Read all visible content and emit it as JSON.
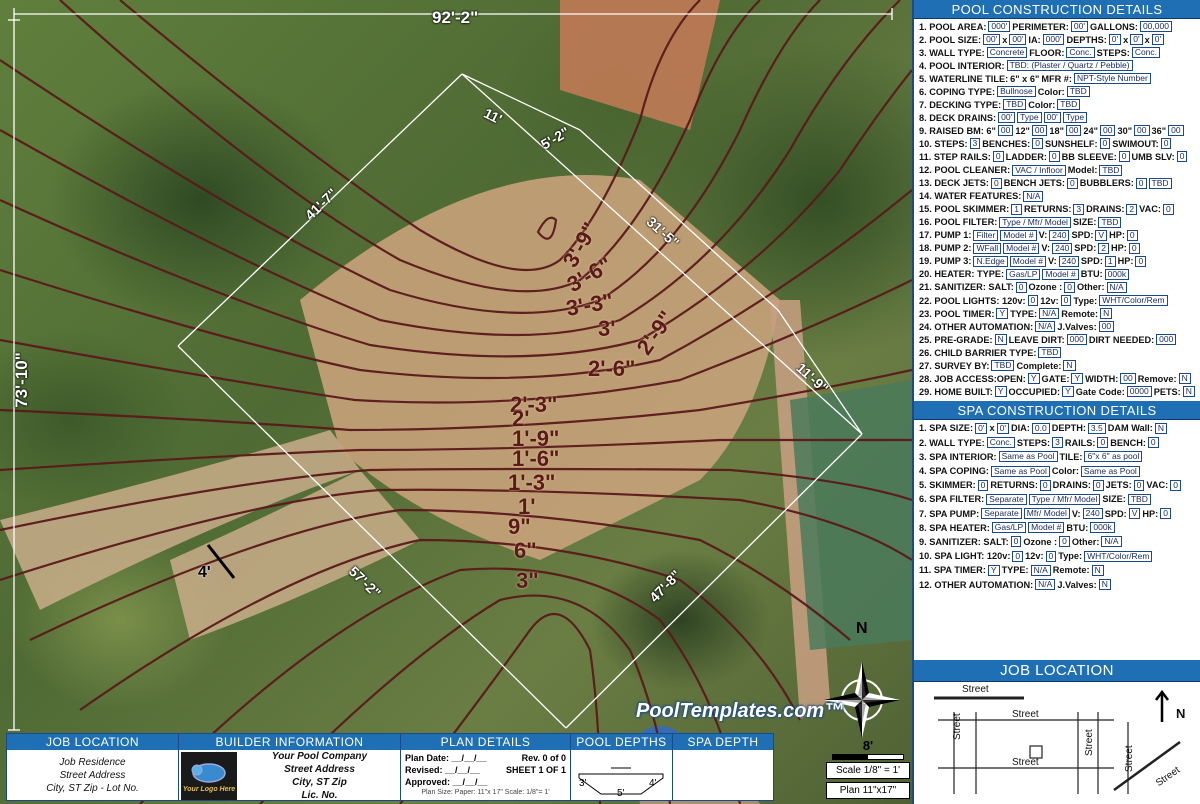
{
  "map": {
    "dimensions": [
      "92'-2\"",
      "73'-10\"",
      "41'-7\"",
      "11'",
      "5'-2\"",
      "31'-5\"",
      "11'-9\"",
      "57'-2\"",
      "47'-8\"",
      "4'"
    ],
    "depth_labels": [
      "3'-9\"",
      "3'-6\"",
      "3'-3\"",
      "3'",
      "2'-9\"",
      "2'-6\"",
      "2'-3\"",
      "2'",
      "1'-9\"",
      "1'-6\"",
      "1'-3\"",
      "1'",
      "9\"",
      "6\"",
      "3\""
    ],
    "watermark": "PoolTemplates.com™",
    "north": "N",
    "scale_bar_label": "8'",
    "scale": "Scale 1/8\" = 1'",
    "plan_size": "Plan 11\"x17\""
  },
  "title_block": {
    "job_location": {
      "header": "JOB LOCATION",
      "lines": [
        "Job Residence",
        "Street Address",
        "City, ST Zip -  Lot No."
      ]
    },
    "builder": {
      "header": "BUILDER INFORMATION",
      "logo_text": "Your Logo Here",
      "lines": [
        "Your Pool Company",
        "Street Address",
        "City, ST Zip",
        "Lic. No."
      ]
    },
    "plan": {
      "header": "PLAN DETAILS",
      "plan_date": "Plan Date:  __/__/__",
      "revised": "Revised:  __/__/__",
      "approved": "Approved:  __/__/__",
      "rev": "Rev. 0 of 0",
      "sheet": "SHEET 1 OF 1",
      "size": "Plan Size:  Paper: 11\"x 17\"  Scale: 1/8\"= 1'"
    },
    "pool_depths": {
      "header": "POOL DEPTHS",
      "shallow": "3'",
      "deep": "4'",
      "mid": "5'"
    },
    "spa_depth": {
      "header": "SPA DEPTH"
    }
  },
  "panel": {
    "pool_header": "POOL CONSTRUCTION DETAILS",
    "pool_rows": [
      [
        "1. POOL AREA:",
        "000'",
        "PERIMETER:",
        "00'",
        "GALLONS:",
        "00,000"
      ],
      [
        "2. POOL SIZE:",
        "00'",
        "x",
        "00'",
        "IA:",
        "000'",
        "DEPTHS:",
        "0'",
        "x",
        "0'",
        "x",
        "0'"
      ],
      [
        "3. WALL TYPE:",
        "Concrete",
        "FLOOR:",
        "Conc.",
        "STEPS:",
        "Conc."
      ],
      [
        "4. POOL INTERIOR:",
        "TBD: (Plaster / Quartz / Pebble)"
      ],
      [
        "5. WATERLINE TILE:",
        "6\" x 6\"",
        "MFR #:",
        "NPT-Style Number"
      ],
      [
        "6. COPING TYPE:",
        "Bullnose",
        "Color:",
        "TBD"
      ],
      [
        "7. DECKING TYPE:",
        "TBD",
        "Color:",
        "TBD"
      ],
      [
        "8. DECK DRAINS:",
        "00'",
        "Type",
        "00'",
        "Type"
      ],
      [
        "9. RAISED BM: 6\"",
        "00",
        "12\"",
        "00",
        "18\"",
        "00",
        "24\"",
        "00",
        "30\"",
        "00",
        "36\"",
        "00"
      ],
      [
        "10. STEPS:",
        "3",
        "BENCHES:",
        "0",
        "SUNSHELF:",
        "0",
        "SWIMOUT:",
        "0"
      ],
      [
        "11. STEP RAILS:",
        "0",
        "LADDER:",
        "0",
        "BB SLEEVE:",
        "0",
        "UMB SLV:",
        "0"
      ],
      [
        "12. POOL CLEANER:",
        "VAC / Infloor",
        "Model:",
        "TBD"
      ],
      [
        "13. DECK JETS:",
        "0",
        "BENCH JETS:",
        "0",
        "BUBBLERS:",
        "0",
        "TBD"
      ],
      [
        "14. WATER FEATURES:",
        "N/A"
      ],
      [
        "15. POOL SKIMMER:",
        "1",
        "RETURNS:",
        "3",
        "DRAINS:",
        "2",
        "VAC:",
        "0"
      ],
      [
        "16. POOL FILTER:",
        "Type / Mfr/ Model",
        "SIZE:",
        "TBD"
      ],
      [
        "17. PUMP 1:",
        "Filter",
        "Model #",
        "V:",
        "240",
        "SPD:",
        "V",
        "HP:",
        "0"
      ],
      [
        "18. PUMP 2:",
        "WFall",
        "Model #",
        "V:",
        "240",
        "SPD:",
        "2",
        "HP:",
        "0"
      ],
      [
        "19. PUMP 3:",
        "N.Edge",
        "Model #",
        "V:",
        "240",
        "SPD:",
        "1",
        "HP:",
        "0"
      ],
      [
        "20. HEATER: TYPE:",
        "Gas/LP",
        "Model #",
        "BTU:",
        "000k"
      ],
      [
        "21. SANITIZER:  SALT:",
        "0",
        "Ozone :",
        "0",
        "Other:",
        "N/A"
      ],
      [
        "22. POOL LIGHTS: 120v:",
        "0",
        "12v:",
        "0",
        "Type:",
        "WHT/Color/Rem"
      ],
      [
        "23. POOL TIMER:",
        "Y",
        "TYPE:",
        "N/A",
        "Remote:",
        "N"
      ],
      [
        "24. OTHER AUTOMATION:",
        "N/A",
        "J.Valves:",
        "00"
      ],
      [
        "25. PRE-GRADE:",
        "N",
        "LEAVE DIRT:",
        "000",
        "DIRT NEEDED:",
        "000"
      ],
      [
        "26. CHILD BARRIER TYPE:",
        "TBD"
      ],
      [
        "27. SURVEY BY:",
        "TBD",
        "Complete:",
        "N"
      ],
      [
        "28. JOB ACCESS:OPEN:",
        "Y",
        "GATE:",
        "Y",
        "WIDTH:",
        "00",
        "Remove:",
        "N"
      ],
      [
        "29. HOME BUILT:",
        "Y",
        "OCCUPIED:",
        "Y",
        "Gate Code:",
        "0000",
        "PETS:",
        "N"
      ]
    ],
    "spa_header": "SPA CONSTRUCTION DETAILS",
    "spa_rows": [
      [
        "1. SPA SIZE:",
        "0'",
        "x",
        "0'",
        "DIA:",
        "0.0",
        "DEPTH:",
        "3.5",
        "DAM Wall:",
        "N"
      ],
      [
        "2. WALL TYPE:",
        "Conc.",
        "STEPS:",
        "3",
        "RAILS:",
        "0",
        "BENCH:",
        "0"
      ],
      [
        "3. SPA INTERIOR:",
        "Same as Pool",
        "TILE:",
        "6\"x 6\" as pool"
      ],
      [
        "4. SPA COPING:",
        "Same as Pool",
        "Color:",
        "Same as Pool"
      ],
      [
        "5. SKIMMER:",
        "0",
        "RETURNS:",
        "0",
        "DRAINS:",
        "0",
        "JETS:",
        "0",
        "VAC:",
        "0"
      ],
      [
        "6. SPA FILTER:",
        "Separate",
        "Type / Mfr/ Model",
        "SIZE:",
        "TBD"
      ],
      [
        "7. SPA PUMP:",
        "Separate",
        "Mfr/ Model",
        "V:",
        "240",
        "SPD:",
        "V",
        "HP:",
        "0"
      ],
      [
        "8. SPA HEATER:",
        "Gas/LP",
        "Model #",
        "BTU:",
        "000k"
      ],
      [
        "9. SANITIZER:  SALT:",
        "0",
        "Ozone :",
        "0",
        "Other:",
        "N/A"
      ],
      [
        "10. SPA LIGHT:  120v:",
        "0",
        "12v:",
        "0",
        "Type:",
        "WHT/Color/Rem"
      ],
      [
        "11. SPA TIMER:",
        "Y",
        "TYPE:",
        "N/A",
        "Remote:",
        "N"
      ],
      [
        "12. OTHER AUTOMATION:",
        "N/A",
        "J.Valves:",
        "N"
      ]
    ],
    "job_header": "JOB LOCATION",
    "streets": [
      "Street",
      "Street",
      "Street",
      "Street",
      "Street",
      "Street",
      "Street"
    ],
    "compass": "N"
  },
  "colors": {
    "header_blue": "#1f6fb5",
    "contour": "#5a1a1a",
    "dim_line": "#ffffff"
  }
}
